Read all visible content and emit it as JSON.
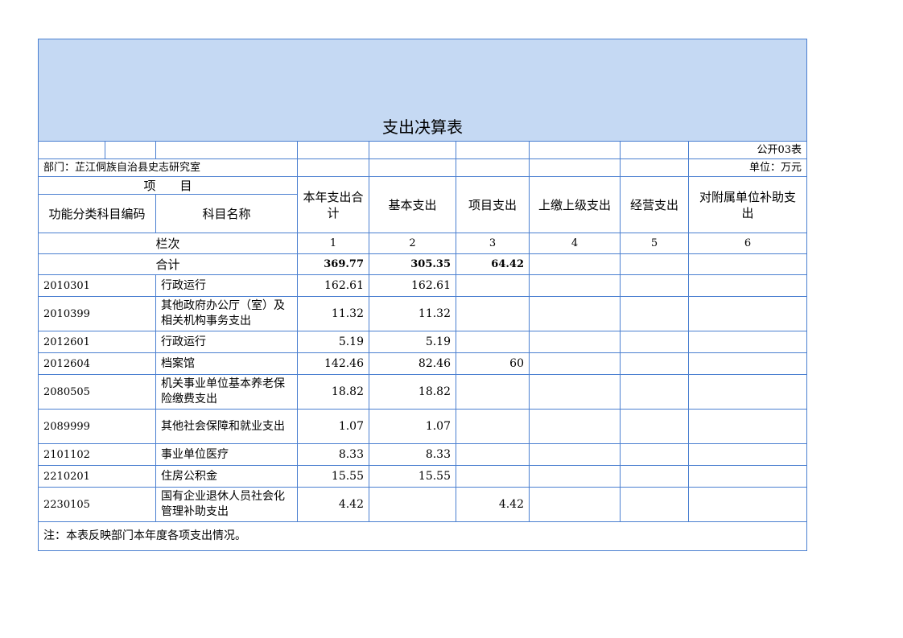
{
  "title": "支出决算表",
  "form_code": "公开03表",
  "department": "部门：芷江侗族自治县史志研究室",
  "unit": "单位：万元",
  "header": {
    "item": "项　　目",
    "code_col": "功能分类科目编码",
    "name_col": "科目名称",
    "total": "本年支出合计",
    "basic": "基本支出",
    "project": "项目支出",
    "upper": "上缴上级支出",
    "business": "经营支出",
    "subsidy": "对附属单位补助支出"
  },
  "column_row": {
    "label": "栏次",
    "nums": [
      "1",
      "2",
      "3",
      "4",
      "5",
      "6"
    ]
  },
  "sum_row": {
    "label": "合计",
    "total": "369.77",
    "basic": "305.35",
    "project": "64.42",
    "upper": "",
    "business": "",
    "subsidy": ""
  },
  "rows": [
    {
      "code": "2010301",
      "name": "行政运行",
      "total": "162.61",
      "basic": "162.61",
      "project": "",
      "upper": "",
      "business": "",
      "subsidy": ""
    },
    {
      "code": "2010399",
      "name": "其他政府办公厅（室）及相关机构事务支出",
      "total": "11.32",
      "basic": "11.32",
      "project": "",
      "upper": "",
      "business": "",
      "subsidy": ""
    },
    {
      "code": "2012601",
      "name": "行政运行",
      "total": "5.19",
      "basic": "5.19",
      "project": "",
      "upper": "",
      "business": "",
      "subsidy": ""
    },
    {
      "code": "2012604",
      "name": "档案馆",
      "total": "142.46",
      "basic": "82.46",
      "project": "60",
      "upper": "",
      "business": "",
      "subsidy": ""
    },
    {
      "code": "2080505",
      "name": "机关事业单位基本养老保险缴费支出",
      "total": "18.82",
      "basic": "18.82",
      "project": "",
      "upper": "",
      "business": "",
      "subsidy": ""
    },
    {
      "code": "2089999",
      "name": "其他社会保障和就业支出",
      "total": "1.07",
      "basic": "1.07",
      "project": "",
      "upper": "",
      "business": "",
      "subsidy": ""
    },
    {
      "code": "2101102",
      "name": "事业单位医疗",
      "total": "8.33",
      "basic": "8.33",
      "project": "",
      "upper": "",
      "business": "",
      "subsidy": ""
    },
    {
      "code": "2210201",
      "name": "住房公积金",
      "total": "15.55",
      "basic": "15.55",
      "project": "",
      "upper": "",
      "business": "",
      "subsidy": ""
    },
    {
      "code": "2230105",
      "name": "国有企业退休人员社会化管理补助支出",
      "total": "4.42",
      "basic": "",
      "project": "4.42",
      "upper": "",
      "business": "",
      "subsidy": ""
    }
  ],
  "note": "注：本表反映部门本年度各项支出情况。"
}
